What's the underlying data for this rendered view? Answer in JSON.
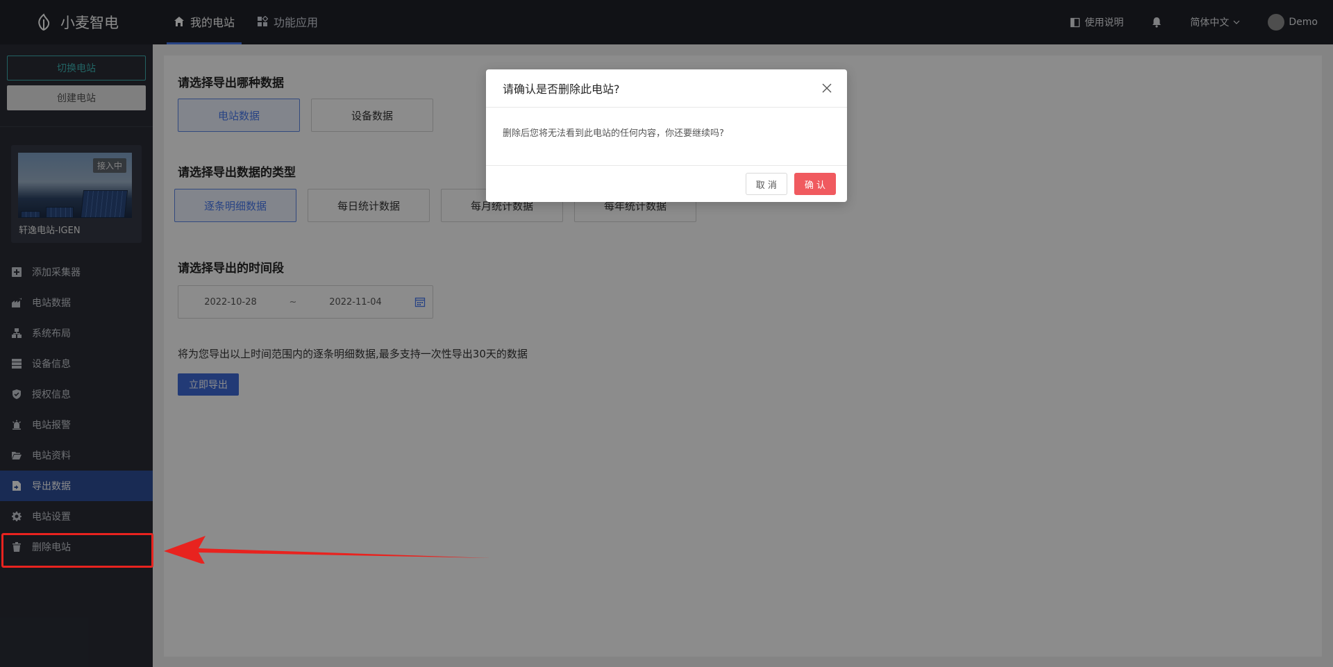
{
  "header": {
    "app_name": "小麦智电",
    "nav": [
      {
        "label": "我的电站",
        "icon": "home-icon",
        "active": true
      },
      {
        "label": "功能应用",
        "icon": "apps-icon",
        "active": false
      }
    ],
    "manual_label": "使用说明",
    "language_label": "简体中文",
    "user_name": "Demo"
  },
  "sidebar": {
    "switch_label": "切换电站",
    "create_label": "创建电站",
    "station": {
      "name": "轩逸电站-IGEN",
      "status": "接入中"
    },
    "menu": [
      {
        "label": "添加采集器",
        "icon": "plus-square-icon",
        "active": false
      },
      {
        "label": "电站数据",
        "icon": "factory-chart-icon",
        "active": false
      },
      {
        "label": "系统布局",
        "icon": "topology-icon",
        "active": false
      },
      {
        "label": "设备信息",
        "icon": "server-icon",
        "active": false
      },
      {
        "label": "授权信息",
        "icon": "shield-check-icon",
        "active": false
      },
      {
        "label": "电站报警",
        "icon": "alarm-icon",
        "active": false
      },
      {
        "label": "电站资料",
        "icon": "folder-open-icon",
        "active": false
      },
      {
        "label": "导出数据",
        "icon": "file-export-icon",
        "active": true
      },
      {
        "label": "电站设置",
        "icon": "gear-icon",
        "active": false
      },
      {
        "label": "删除电站",
        "icon": "trash-icon",
        "active": false
      }
    ]
  },
  "main": {
    "section1_title": "请选择导出哪种数据",
    "data_kinds": [
      {
        "label": "电站数据",
        "active": true
      },
      {
        "label": "设备数据",
        "active": false
      }
    ],
    "section2_title": "请选择导出数据的类型",
    "data_types": [
      {
        "label": "逐条明细数据",
        "active": true
      },
      {
        "label": "每日统计数据",
        "active": false
      },
      {
        "label": "每月统计数据",
        "active": false
      },
      {
        "label": "每年统计数据",
        "active": false
      }
    ],
    "section3_title": "请选择导出的时间段",
    "date_start": "2022-10-28",
    "date_separator": "~",
    "date_end": "2022-11-04",
    "info_text": "将为您导出以上时间范围内的逐条明细数据,最多支持一次性导出30天的数据",
    "export_label": "立即导出"
  },
  "modal": {
    "title": "请确认是否删除此电站?",
    "body": "删除后您将无法看到此电站的任何内容，你还要继续吗?",
    "cancel_label": "取 消",
    "ok_label": "确 认"
  },
  "colors": {
    "topbar": "#1f2229",
    "sidebar": "#2a2d36",
    "active_menu": "#2f4f9a",
    "primary": "#3f6ad8",
    "danger": "#f05a5f",
    "annotation": "#e8231f"
  }
}
